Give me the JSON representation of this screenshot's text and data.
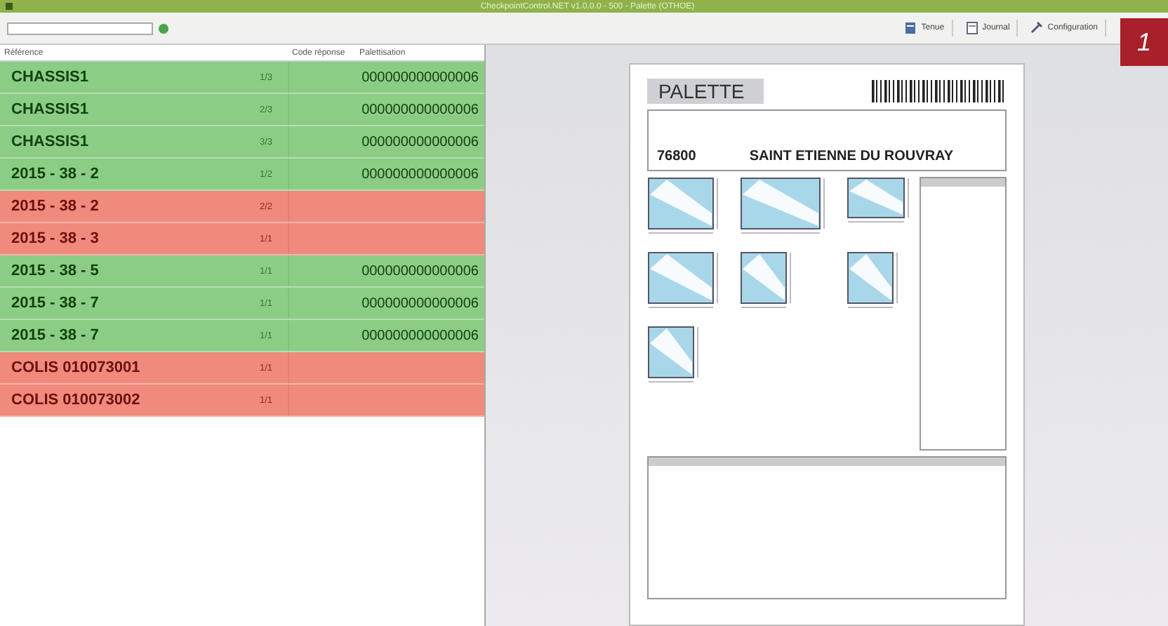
{
  "window": {
    "title": "CheckpointControl.NET v1.0.0.0 - 500 - Palette (OTHOE)"
  },
  "toolbar": {
    "buttons": [
      {
        "label": "Tenue"
      },
      {
        "label": "Journal"
      },
      {
        "label": "Configuration"
      }
    ]
  },
  "table": {
    "columns": [
      "Référence",
      "Code réponse",
      "Palettisation"
    ],
    "rows": [
      {
        "reference": "CHASSIS1",
        "count": "1/3",
        "palettisation": "000000000000006",
        "error": false
      },
      {
        "reference": "CHASSIS1",
        "count": "2/3",
        "palettisation": "000000000000006",
        "error": false
      },
      {
        "reference": "CHASSIS1",
        "count": "3/3",
        "palettisation": "000000000000006",
        "error": false
      },
      {
        "reference": "2015 - 38 - 2",
        "count": "1/2",
        "palettisation": "000000000000006",
        "error": false
      },
      {
        "reference": "2015 - 38 - 2",
        "count": "2/2",
        "error": true
      },
      {
        "reference": "2015 - 38 - 3",
        "count": "1/1",
        "error": true
      },
      {
        "reference": "2015 - 38 - 5",
        "count": "1/1",
        "palettisation": "000000000000006",
        "error": false
      },
      {
        "reference": "2015 - 38 - 7",
        "count": "1/1",
        "palettisation": "000000000000006",
        "error": false
      },
      {
        "reference": "2015 - 38 - 7",
        "count": "1/1",
        "palettisation": "000000000000006",
        "error": false
      },
      {
        "reference": "COLIS 010073001",
        "count": "1/1",
        "error": true
      },
      {
        "reference": "COLIS 010073002",
        "count": "1/1",
        "error": true
      }
    ]
  },
  "preview": {
    "title": "PALETTE",
    "postcode": "76800",
    "city": "SAINT ETIENNE DU ROUVRAY"
  },
  "figure_number": "1"
}
